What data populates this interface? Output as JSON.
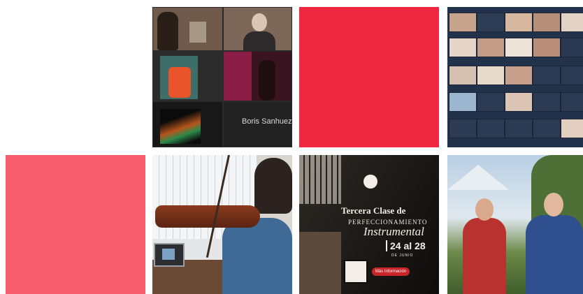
{
  "colors": {
    "accent_red": "#ef2741",
    "accent_pink": "#f85e70"
  },
  "grid": {
    "tiles": [
      {
        "kind": "video-call-screenshot",
        "participant_label": "Boris Sanhueza"
      },
      {
        "kind": "solid-red-tile"
      },
      {
        "kind": "video-call-gallery-screenshot"
      },
      {
        "kind": "solid-pink-tile"
      },
      {
        "kind": "photo-violin-student"
      },
      {
        "kind": "poster",
        "title_line1": "Tercera Clase de",
        "title_line2": "PERFECCIONAMIENTO",
        "title_line3": "Instrumental",
        "dates": "24 al 28",
        "month": "DE JUNIO",
        "button_label": "Más Información"
      },
      {
        "kind": "photo-two-people-outdoors"
      }
    ]
  }
}
